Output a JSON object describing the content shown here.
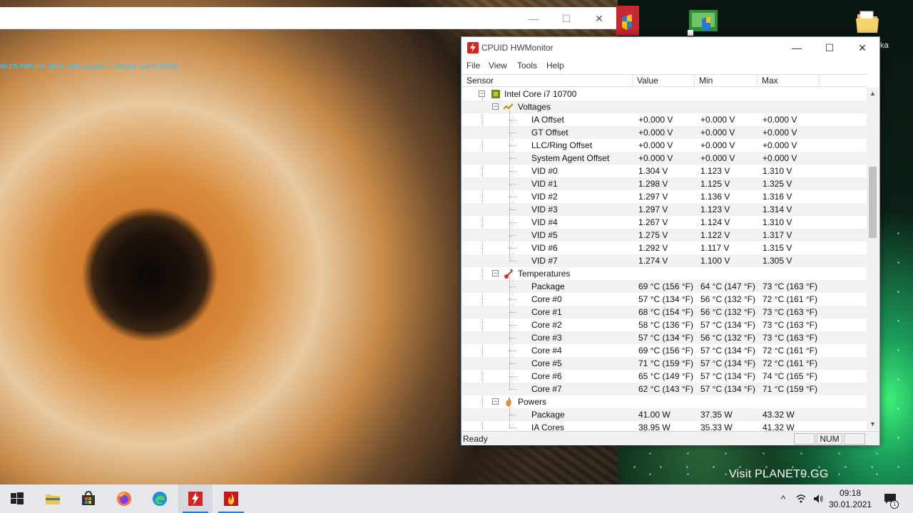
{
  "background_window": {
    "minimize": "—",
    "maximize": "☐",
    "close": "✕"
  },
  "overlay": {
    "stats_text": "00.1% TDP, fan: 63%, limits:[power:1, temp:0, volt:0, OV:0]"
  },
  "desktop": {
    "folder_label": "ka",
    "promo": "Visit PLANET9.GG"
  },
  "window": {
    "title": "CPUID HWMonitor",
    "minimize": "—",
    "maximize": "☐",
    "close": "✕",
    "menu": [
      "File",
      "View",
      "Tools",
      "Help"
    ],
    "columns": [
      "Sensor",
      "Value",
      "Min",
      "Max"
    ],
    "cpu_name": "Intel Core i7 10700",
    "groups": [
      {
        "name": "Voltages",
        "icon": "voltage-icon",
        "rows": [
          [
            "IA Offset",
            "+0.000 V",
            "+0.000 V",
            "+0.000 V"
          ],
          [
            "GT Offset",
            "+0.000 V",
            "+0.000 V",
            "+0.000 V"
          ],
          [
            "LLC/Ring Offset",
            "+0.000 V",
            "+0.000 V",
            "+0.000 V"
          ],
          [
            "System Agent Offset",
            "+0.000 V",
            "+0.000 V",
            "+0.000 V"
          ],
          [
            "VID #0",
            "1.304 V",
            "1.123 V",
            "1.310 V"
          ],
          [
            "VID #1",
            "1.298 V",
            "1.125 V",
            "1.325 V"
          ],
          [
            "VID #2",
            "1.297 V",
            "1.136 V",
            "1.316 V"
          ],
          [
            "VID #3",
            "1.297 V",
            "1.123 V",
            "1.314 V"
          ],
          [
            "VID #4",
            "1.267 V",
            "1.124 V",
            "1.310 V"
          ],
          [
            "VID #5",
            "1.275 V",
            "1.122 V",
            "1.317 V"
          ],
          [
            "VID #6",
            "1.292 V",
            "1.117 V",
            "1.315 V"
          ],
          [
            "VID #7",
            "1.274 V",
            "1.100 V",
            "1.305 V"
          ]
        ]
      },
      {
        "name": "Temperatures",
        "icon": "thermometer-icon",
        "rows": [
          [
            "Package",
            "69 °C  (156 °F)",
            "64 °C  (147 °F)",
            "73 °C  (163 °F)"
          ],
          [
            "Core #0",
            "57 °C  (134 °F)",
            "56 °C  (132 °F)",
            "72 °C  (161 °F)"
          ],
          [
            "Core #1",
            "68 °C  (154 °F)",
            "56 °C  (132 °F)",
            "73 °C  (163 °F)"
          ],
          [
            "Core #2",
            "58 °C  (136 °F)",
            "57 °C  (134 °F)",
            "73 °C  (163 °F)"
          ],
          [
            "Core #3",
            "57 °C  (134 °F)",
            "56 °C  (132 °F)",
            "73 °C  (163 °F)"
          ],
          [
            "Core #4",
            "69 °C  (156 °F)",
            "57 °C  (134 °F)",
            "72 °C  (161 °F)"
          ],
          [
            "Core #5",
            "71 °C  (159 °F)",
            "57 °C  (134 °F)",
            "72 °C  (161 °F)"
          ],
          [
            "Core #6",
            "65 °C  (149 °F)",
            "57 °C  (134 °F)",
            "74 °C  (165 °F)"
          ],
          [
            "Core #7",
            "62 °C  (143 °F)",
            "57 °C  (134 °F)",
            "71 °C  (159 °F)"
          ]
        ]
      },
      {
        "name": "Powers",
        "icon": "flame-icon",
        "rows": [
          [
            "Package",
            "41.00 W",
            "37.35 W",
            "43.32 W"
          ],
          [
            "IA Cores",
            "38.95 W",
            "35.33 W",
            "41.32 W"
          ]
        ]
      }
    ],
    "status": {
      "text": "Ready",
      "num": "NUM"
    }
  },
  "taskbar": {
    "apps": [
      "windows-start-icon",
      "file-explorer-icon",
      "microsoft-store-icon",
      "firefox-icon",
      "edge-icon",
      "hwmonitor-icon",
      "flame-app-icon"
    ],
    "clock_time": "09:18",
    "clock_date": "30.01.2021",
    "tray_chevron": "^",
    "notification_badge": "1"
  },
  "colors": {
    "taskbar": "#e6e8ec",
    "accent": "#2a7ad3",
    "overlay_text": "#30c8ff",
    "hwmonitor_red": "#d6221d"
  }
}
